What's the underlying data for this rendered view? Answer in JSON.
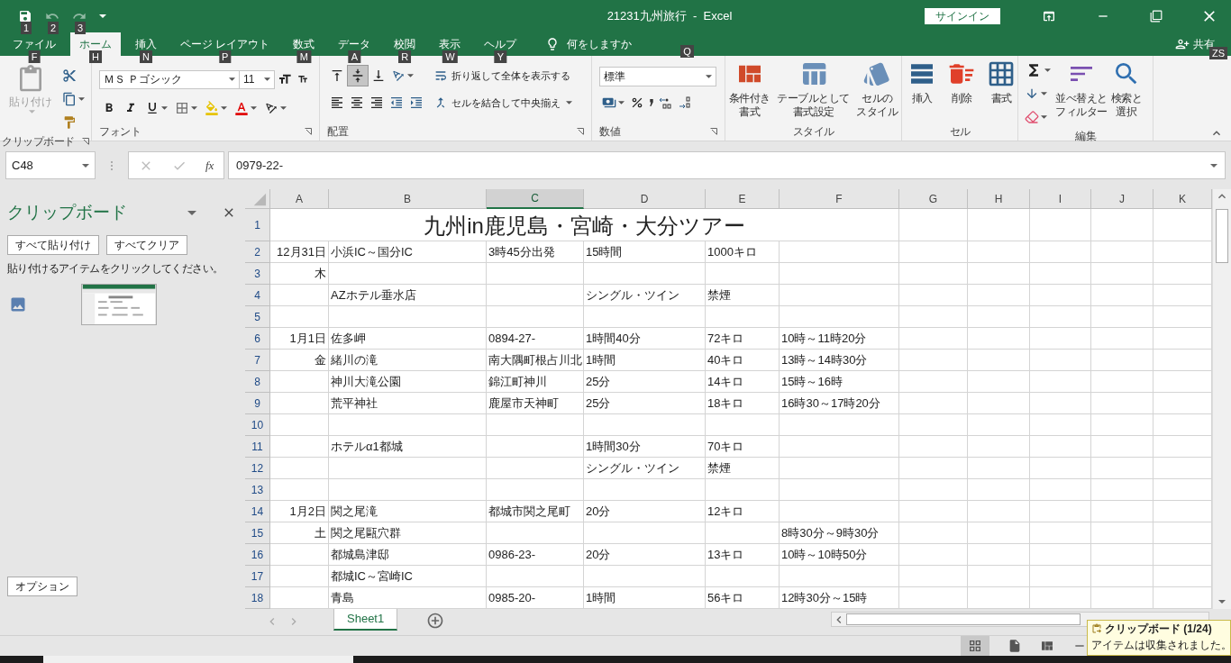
{
  "title_bar": {
    "quick_access_keytips": [
      "1",
      "2",
      "3"
    ],
    "title": "21231九州旅行  -  Excel",
    "sign_in": "サインイン"
  },
  "menu_tabs": [
    {
      "label": "ファイル",
      "keytip": "F",
      "selected": false
    },
    {
      "label": "ホーム",
      "keytip": "H",
      "selected": true
    },
    {
      "label": "挿入",
      "keytip": "N",
      "selected": false
    },
    {
      "label": "ページ レイアウト",
      "keytip": "P",
      "selected": false
    },
    {
      "label": "数式",
      "keytip": "M",
      "selected": false
    },
    {
      "label": "データ",
      "keytip": "A",
      "selected": false
    },
    {
      "label": "校閲",
      "keytip": "R",
      "selected": false
    },
    {
      "label": "表示",
      "keytip": "W",
      "selected": false
    },
    {
      "label": "ヘルプ",
      "keytip": "Y",
      "selected": false
    }
  ],
  "tell_me": {
    "label": "何をしますか",
    "keytip": "Q"
  },
  "share": {
    "label": "共有",
    "keytip": "ZS"
  },
  "ribbon": {
    "clipboard": {
      "label": "クリップボード",
      "paste": "貼り付け"
    },
    "font": {
      "label": "フォント",
      "font_name": "ＭＳ Ｐゴシック",
      "font_size": "11"
    },
    "alignment": {
      "label": "配置",
      "wrap": "折り返して全体を表示する",
      "merge": "セルを結合して中央揃え"
    },
    "number": {
      "label": "数値",
      "format": "標準"
    },
    "styles": {
      "label": "スタイル",
      "buttons": [
        [
          "条件付き",
          "書式"
        ],
        [
          "テーブルとして",
          "書式設定"
        ],
        [
          "セルの",
          "スタイル"
        ]
      ]
    },
    "cells": {
      "label": "セル",
      "buttons": [
        [
          "挿入"
        ],
        [
          "削除"
        ],
        [
          "書式"
        ]
      ]
    },
    "editing": {
      "label": "編集",
      "buttons": [
        [
          "並べ替えと",
          "フィルター"
        ],
        [
          "検索と",
          "選択"
        ]
      ]
    }
  },
  "formula_bar": {
    "name_box": "C48",
    "function_button": "fx",
    "value": "0979-22-"
  },
  "clipboard_pane": {
    "title": "クリップボード",
    "buttons": [
      "すべて貼り付け",
      "すべてクリア"
    ],
    "hint": "貼り付けるアイテムをクリックしてください。",
    "options": "オプション"
  },
  "sheet": {
    "columns": [
      {
        "label": "A",
        "selected": false
      },
      {
        "label": "B",
        "selected": false
      },
      {
        "label": "C",
        "selected": true
      },
      {
        "label": "D",
        "selected": false
      },
      {
        "label": "E",
        "selected": false
      },
      {
        "label": "F",
        "selected": false
      },
      {
        "label": "G",
        "selected": false
      },
      {
        "label": "H",
        "selected": false
      },
      {
        "label": "I",
        "selected": false
      },
      {
        "label": "J",
        "selected": false
      },
      {
        "label": "K",
        "selected": false
      }
    ],
    "rows": [
      {
        "number": "1",
        "title": "九州in鹿児島・宮崎・大分ツアー"
      },
      {
        "number": "2",
        "cells": [
          "12月31日",
          "小浜IC～国分IC",
          "3時45分出発",
          "15時間",
          "1000キロ"
        ]
      },
      {
        "number": "3",
        "cells": [
          "木"
        ]
      },
      {
        "number": "4",
        "cells": [
          null,
          "AZホテル垂水店",
          null,
          "シングル・ツイン",
          "禁煙"
        ]
      },
      {
        "number": "5"
      },
      {
        "number": "6",
        "cells": [
          "1月1日",
          "佐多岬",
          "0894-27-",
          "1時間40分",
          "72キロ",
          "10時～11時20分"
        ]
      },
      {
        "number": "7",
        "cells": [
          "金",
          "緒川の滝",
          "南大隅町根占川北",
          "1時間",
          "40キロ",
          "13時～14時30分"
        ]
      },
      {
        "number": "8",
        "cells": [
          null,
          "神川大滝公園",
          "錦江町神川",
          "25分",
          "14キロ",
          "15時～16時"
        ]
      },
      {
        "number": "9",
        "cells": [
          null,
          "荒平神社",
          "鹿屋市天神町",
          "25分",
          "18キロ",
          "16時30～17時20分"
        ]
      },
      {
        "number": "10"
      },
      {
        "number": "11",
        "cells": [
          null,
          "ホテルα1都城",
          null,
          "1時間30分",
          "70キロ"
        ]
      },
      {
        "number": "12",
        "cells": [
          null,
          null,
          null,
          "シングル・ツイン",
          "禁煙"
        ]
      },
      {
        "number": "13"
      },
      {
        "number": "14",
        "cells": [
          "1月2日",
          "関之尾滝",
          "都城市関之尾町",
          "20分",
          "12キロ"
        ]
      },
      {
        "number": "15",
        "cells": [
          "土",
          "関之尾甌穴群",
          null,
          null,
          null,
          "8時30分～9時30分"
        ]
      },
      {
        "number": "16",
        "cells": [
          null,
          "都城島津邸",
          "0986-23-",
          "20分",
          "13キロ",
          "10時～10時50分"
        ]
      },
      {
        "number": "17",
        "cells": [
          null,
          "都城IC～宮崎IC"
        ]
      },
      {
        "number": "18",
        "cells": [
          null,
          "青島",
          "0985-20-",
          "1時間",
          "56キロ",
          "12時30分～15時"
        ]
      }
    ]
  },
  "sheet_tabs": [
    {
      "label": "Sheet1",
      "selected": true
    }
  ],
  "notification": {
    "title": "クリップボード (1/24)",
    "message": "アイテムは収集されました。"
  }
}
